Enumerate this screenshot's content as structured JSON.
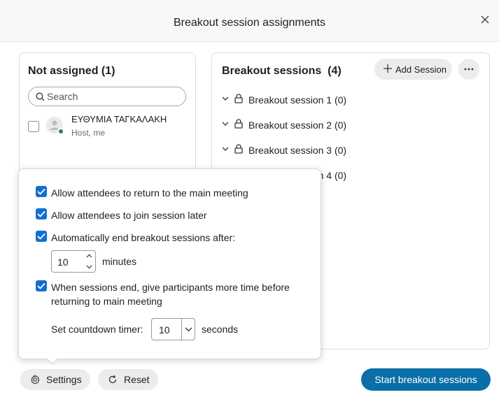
{
  "header": {
    "title": "Breakout session assignments",
    "close_icon": "close-icon"
  },
  "not_assigned": {
    "title": "Not assigned (1)",
    "search_placeholder": "Search",
    "participants": [
      {
        "name": "ΕΥΘΥΜΙΑ ΤΑΓΚΑΛΑΚΗ",
        "role": "Host, me",
        "checked": false
      }
    ]
  },
  "sessions": {
    "title": "Breakout sessions  (4)",
    "add_label": "Add Session",
    "items": [
      {
        "label": "Breakout session 1 (0)"
      },
      {
        "label": "Breakout session 2 (0)"
      },
      {
        "label": "Breakout session 3 (0)"
      },
      {
        "label": "Breakout session 4 (0)"
      }
    ]
  },
  "settings_popover": {
    "options": [
      {
        "label": "Allow attendees to return to the main meeting",
        "checked": true
      },
      {
        "label": "Allow attendees to join session later",
        "checked": true
      },
      {
        "label": "Automatically end breakout sessions after:",
        "checked": true
      },
      {
        "label_line1": "When sessions end, give participants more time before",
        "label_line2": "returning to main meeting",
        "checked": true
      }
    ],
    "auto_end_minutes": "10",
    "minutes_label": "minutes",
    "countdown_label": "Set countdown timer:",
    "countdown_value": "10",
    "seconds_label": "seconds"
  },
  "footer": {
    "settings_label": "Settings",
    "reset_label": "Reset",
    "start_label": "Start breakout sessions"
  },
  "colors": {
    "accent": "#1170cf",
    "primary_button": "#0a6ea8",
    "presence": "#1b8a5a"
  }
}
